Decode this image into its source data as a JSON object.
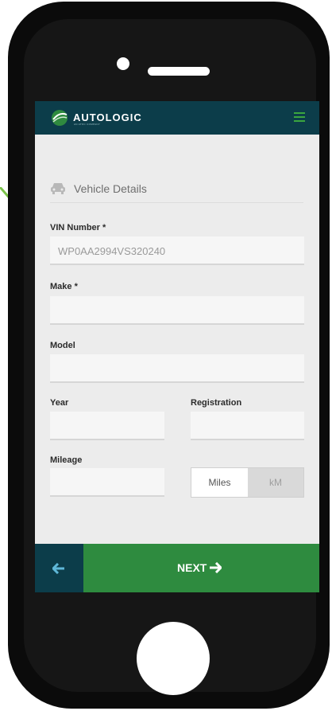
{
  "app": {
    "brand": "AUTOLOGIC",
    "tagline": "AN ATOC COMPANY"
  },
  "section": {
    "title": "Vehicle Details",
    "icon": "car-icon"
  },
  "form": {
    "vin": {
      "label": "VIN Number *",
      "value": "WP0AA2994VS320240"
    },
    "make": {
      "label": "Make *",
      "value": ""
    },
    "model": {
      "label": "Model",
      "value": ""
    },
    "year": {
      "label": "Year",
      "value": ""
    },
    "registration": {
      "label": "Registration",
      "value": ""
    },
    "mileage": {
      "label": "Mileage",
      "value": ""
    },
    "units": {
      "miles": "Miles",
      "km": "kM",
      "selected": "Miles"
    }
  },
  "footer": {
    "next_label": "NEXT",
    "back_icon": "arrow-left-icon",
    "next_icon": "arrow-right-icon"
  },
  "colors": {
    "header": "#0c3d4a",
    "accent": "#2e8b3f",
    "annotation_arrow": "#7cc24a"
  }
}
